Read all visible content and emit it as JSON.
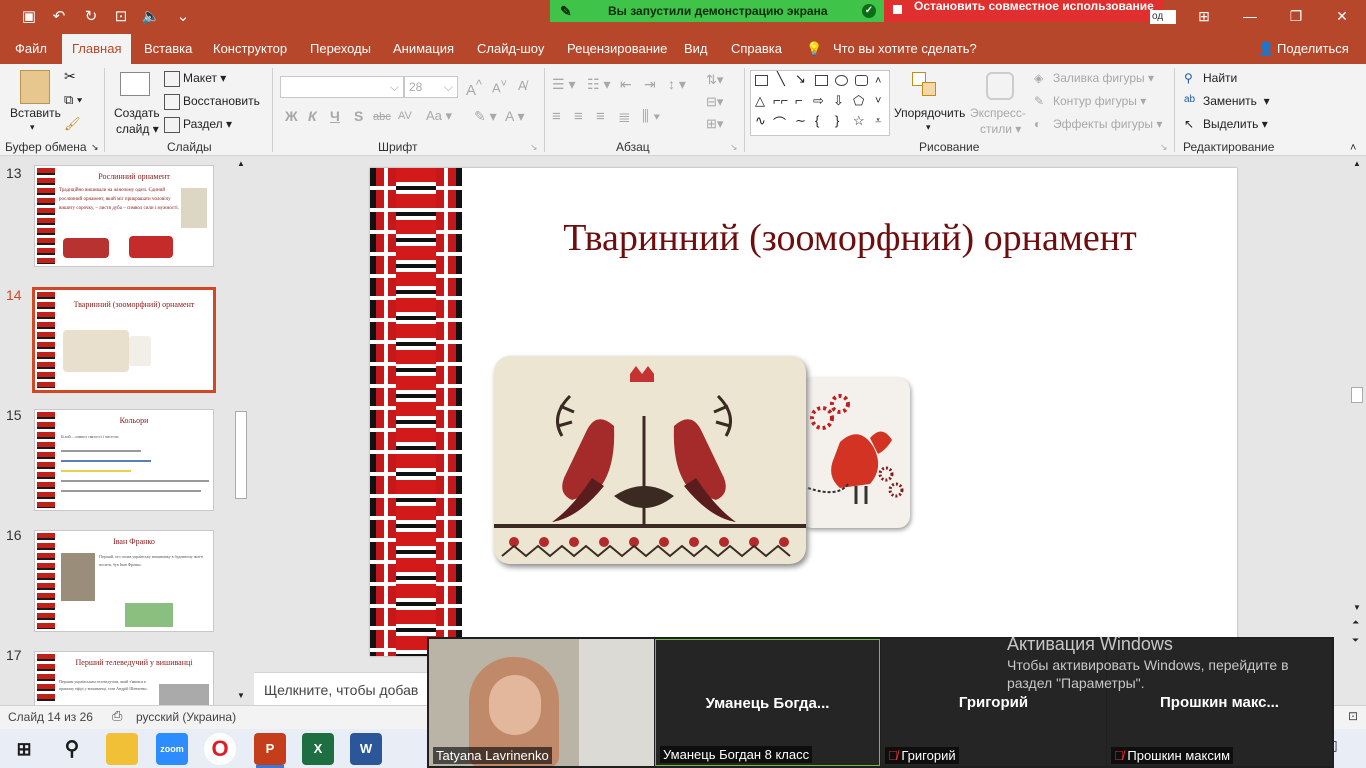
{
  "titlebar": {
    "share_text": "Вы запустили демонстрацию экрана",
    "stop_text": "Остановить совместное использование",
    "hidden_fragment": "од"
  },
  "tabs": [
    "Файл",
    "Главная",
    "Вставка",
    "Конструктор",
    "Переходы",
    "Анимация",
    "Слайд-шоу",
    "Рецензирование",
    "Вид",
    "Справка"
  ],
  "tell_me": "Что вы хотите сделать?",
  "share_button": "Поделиться",
  "ribbon": {
    "clipboard": {
      "paste": "Вставить",
      "label": "Буфер обмена"
    },
    "slides": {
      "new_slide_line1": "Создать",
      "new_slide_line2": "слайд",
      "layout": "Макет",
      "reset": "Восстановить",
      "section": "Раздел",
      "label": "Слайды"
    },
    "font": {
      "size": "28",
      "label": "Шрифт",
      "buttons": [
        "Ж",
        "К",
        "Ч",
        "S",
        "abc",
        "AV",
        "Aa",
        "A"
      ]
    },
    "paragraph": {
      "label": "Абзац"
    },
    "drawing": {
      "arrange_line1": "Упорядочить",
      "quick_styles_line1": "Экспресс-",
      "quick_styles_line2": "стили",
      "fill": "Заливка фигуры",
      "outline": "Контур фигуры",
      "effects": "Эффекты фигуры",
      "label": "Рисование"
    },
    "editing": {
      "find": "Найти",
      "replace": "Заменить",
      "select": "Выделить",
      "label": "Редактирование"
    }
  },
  "thumbnails": [
    {
      "num": "13",
      "title": "Рослинний орнамент",
      "text": "Традиційно вишивали на жіночому одязі. Єдиний рослинний орнамент, який міг прикрашати чоловічу вишиту сорочку, – листя дуба – символ сили і мужності."
    },
    {
      "num": "14",
      "title": "Тваринний (зооморфний) орнамент",
      "text": ""
    },
    {
      "num": "15",
      "title": "Кольори",
      "text": "Білий – символ святості і чистоти."
    },
    {
      "num": "16",
      "title": "Іван Франко",
      "text": "Перший, хто почав українську вишиванку в буденному житті носити, був Іван Франко."
    },
    {
      "num": "17",
      "title": "Перший телеведучий у вишиванці",
      "text": "Першим українським телеведучим, який з'явився в прямому ефірі у вишиванці, став Андрій Шевченко."
    }
  ],
  "slide": {
    "title": "Тваринний (зооморфний) орнамент"
  },
  "notes_placeholder": "Щелкните, чтобы добав",
  "status": {
    "slide_info": "Слайд 14 из 26",
    "language": "русский (Украина)"
  },
  "zoom": {
    "tiles": [
      {
        "name": "Tatyana Lavrinenko",
        "big": ""
      },
      {
        "name": "Уманець Богдан 8 класс",
        "big": "Уманець  Богда..."
      },
      {
        "name": "Григорий",
        "big": "Григорий"
      },
      {
        "name": "Прошкин максим",
        "big": "Прошкин  макс..."
      }
    ]
  },
  "activation": {
    "title": "Активация Windows",
    "line1": "Чтобы активировать Windows, перейдите в",
    "line2": "раздел \"Параметры\"."
  },
  "taskbar": [
    "start-icon",
    "search-icon",
    "file-explorer-icon",
    "zoom-icon",
    "opera-icon",
    "powerpoint-icon",
    "excel-icon",
    "word-icon"
  ],
  "colors": {
    "ppt_red": "#b7472a",
    "title_red": "#6e0d0d",
    "share_green": "#3fc449",
    "stop_red": "#e02f2f"
  }
}
